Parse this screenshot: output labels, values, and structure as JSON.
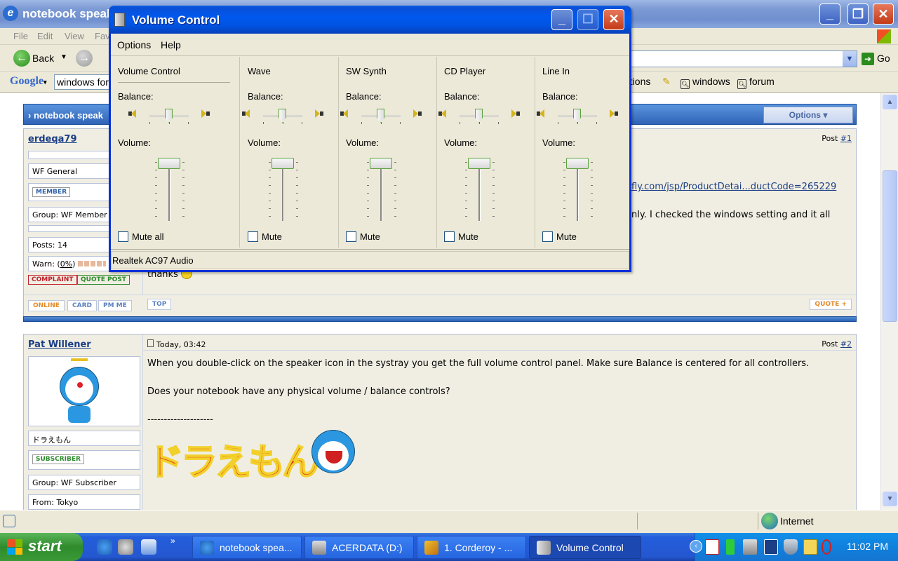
{
  "ie": {
    "title": "notebook speak",
    "menu": [
      "File",
      "Edit",
      "View",
      "Fav"
    ],
    "back_label": "Back",
    "go_label": "Go",
    "google_logo": "Google",
    "google_search_value": "windows for",
    "google_buttons": [
      "otions",
      "windows",
      "forum"
    ],
    "status_zone": "Internet"
  },
  "forum": {
    "header_title": "notebook speak",
    "options_label": "Options ▾",
    "post1": {
      "user": "erdeqa79",
      "rank": "WF General",
      "badge": "MEMBER",
      "group": "Group: WF Member",
      "posts": "Posts: 14",
      "warn_prefix": "Warn: (",
      "warn_pct": "0%",
      "warn_suffix": ")",
      "complaint": "COMPLAINT",
      "quote_post": "QUOTE POST",
      "post_label": "Post",
      "post_num": "#1",
      "link_text": "fly.com/jsp/ProductDetai...ductCode=265229",
      "line2": "nly. I checked the windows setting and it all",
      "thanks": "thanks",
      "online": "ONLINE",
      "card": "CARD",
      "pm": "PM ME",
      "top": "TOP",
      "quote": "QUOTE +"
    },
    "post2": {
      "user": "Pat Willener",
      "date": "Today, 03:42",
      "post_label": "Post",
      "post_num": "#2",
      "name_jp": "ドラえもん",
      "badge": "SUBSCRIBER",
      "group": "Group: WF Subscriber",
      "from": "From: Tokyo",
      "line1": "When you double-click on the speaker icon in the systray you get the full volume control panel. Make sure Balance is centered for all controllers.",
      "line2": "Does your notebook have any physical volume / balance controls?",
      "sig_rule": "--------------------",
      "sig_logo": "ドラえもん"
    }
  },
  "vc": {
    "title": "Volume Control",
    "menu": [
      "Options",
      "Help"
    ],
    "balance_label": "Balance:",
    "volume_label": "Volume:",
    "channels": [
      {
        "name": "Volume Control",
        "mute_label": "Mute all",
        "balance": 0.5,
        "volume": 1.0
      },
      {
        "name": "Wave",
        "mute_label": "Mute",
        "balance": 0.5,
        "volume": 1.0
      },
      {
        "name": "SW Synth",
        "mute_label": "Mute",
        "balance": 0.5,
        "volume": 1.0
      },
      {
        "name": "CD Player",
        "mute_label": "Mute",
        "balance": 0.5,
        "volume": 1.0
      },
      {
        "name": "Line In",
        "mute_label": "Mute",
        "balance": 0.5,
        "volume": 1.0
      }
    ],
    "status": "Realtek AC97 Audio"
  },
  "taskbar": {
    "start_label": "start",
    "tasks": [
      "notebook spea...",
      "ACERDATA (D:)",
      "1. Corderoy - ...",
      "Volume Control"
    ],
    "clock": "11:02 PM"
  }
}
